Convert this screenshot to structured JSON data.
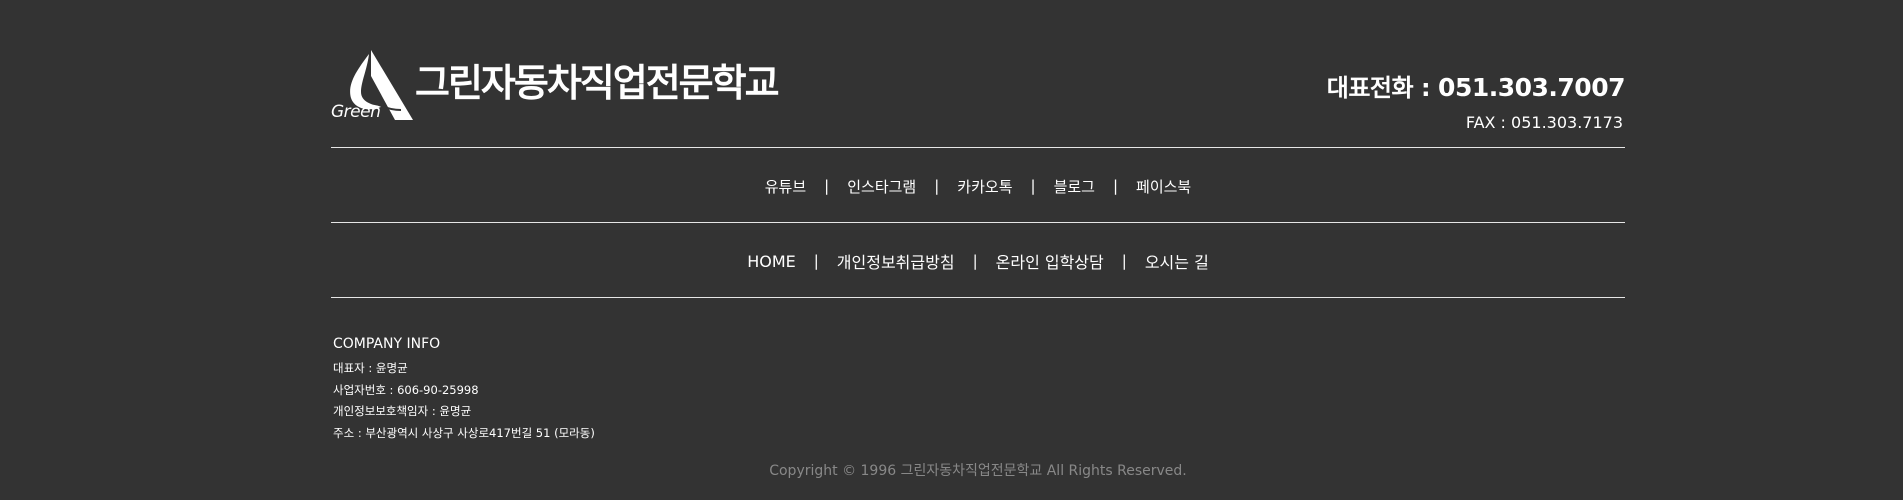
{
  "brand": {
    "logo_word": "Green",
    "school_name": "그린자동차직업전문학교"
  },
  "contact": {
    "phone_label": "대표전화 :",
    "phone_number": "051.303.7007",
    "fax": "FAX : 051.303.7173"
  },
  "social_links": [
    "유튜브",
    "인스타그램",
    "카카오톡",
    "블로그",
    "페이스북"
  ],
  "footer_links": [
    "HOME",
    "개인정보취급방침",
    "온라인 입학상담",
    "오시는 길"
  ],
  "separator": "|",
  "company_info": {
    "title": "COMPANY INFO",
    "lines": [
      "대표자 : 윤명균",
      "사업자번호 : 606-90-25998",
      "개인정보보호책임자 : 윤명균",
      "주소 : 부산광역시 사상구 사상로417번길 51 (모라동)"
    ]
  },
  "copyright": "Copyright © 1996 그린자동차직업전문학교 All Rights Reserved.",
  "colors": {
    "background": "#333333",
    "text": "#ffffff",
    "muted": "#888888",
    "rule": "#e6e6e6"
  }
}
